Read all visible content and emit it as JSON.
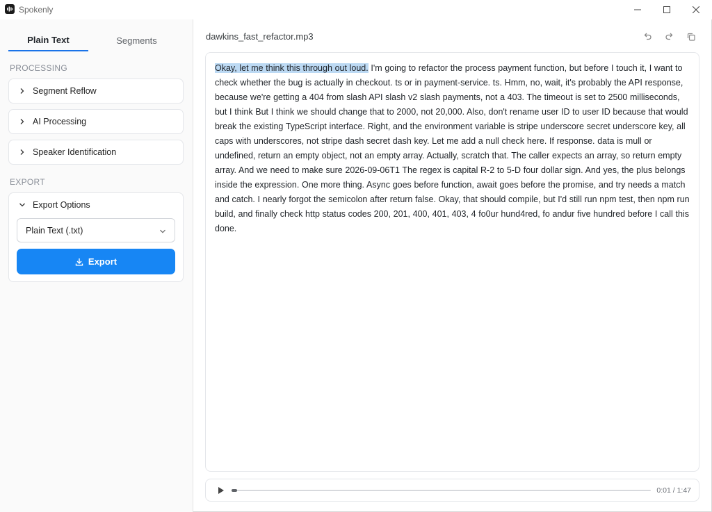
{
  "app": {
    "title": "Spokenly"
  },
  "sidebar": {
    "tabs": [
      {
        "label": "Plain Text",
        "active": true
      },
      {
        "label": "Segments",
        "active": false
      }
    ],
    "processing_label": "PROCESSING",
    "processing_items": [
      {
        "label": "Segment Reflow"
      },
      {
        "label": "AI Processing"
      },
      {
        "label": "Speaker Identification"
      }
    ],
    "export_label": "EXPORT",
    "export_options": {
      "title": "Export Options",
      "format_selected": "Plain Text (.txt)",
      "button_label": "Export"
    }
  },
  "main": {
    "file_name": "dawkins_fast_refactor.mp3",
    "transcript": {
      "highlighted": "Okay, let me think this through out loud.",
      "rest": " I'm going to refactor the process payment function, but before I touch it, I want to check whether the bug is actually in checkout. ts or in payment-service. ts. Hmm, no, wait, it's probably the API response, because we're getting a 404 from slash API slash v2 slash payments, not a 403. The timeout is set to 2500 milliseconds, but I think But I think we should change that to 2000, not 20,000. Also, don't rename user ID to user ID because that would break the existing TypeScript interface. Right, and the environment variable is stripe underscore secret underscore key, all caps with underscores, not stripe dash secret dash key. Let me add a null check here. If response. data is mull or undefined, return an empty object, not an empty array. Actually, scratch that. The caller expects an array, so return empty array. And we need to make sure 2026-09-06T1 The regex is capital R-2 to 5-D four dollar sign. And yes, the plus belongs inside the expression. One more thing. Async goes before function, await goes before the promise, and try needs a match and catch. I nearly forgot the semicolon after return false. Okay, that should compile, but I'd still run npm test, then npm run build, and finally check http status codes 200, 201, 400, 401, 403, 4 fo0ur hund4red, fo andur five hundred before I call this done."
    },
    "player": {
      "time": "0:01 / 1:47",
      "progress": 0.0093
    }
  },
  "colors": {
    "accent": "#1786f4",
    "highlight": "#bcd9f3",
    "tab_underline": "#1a73e8"
  }
}
